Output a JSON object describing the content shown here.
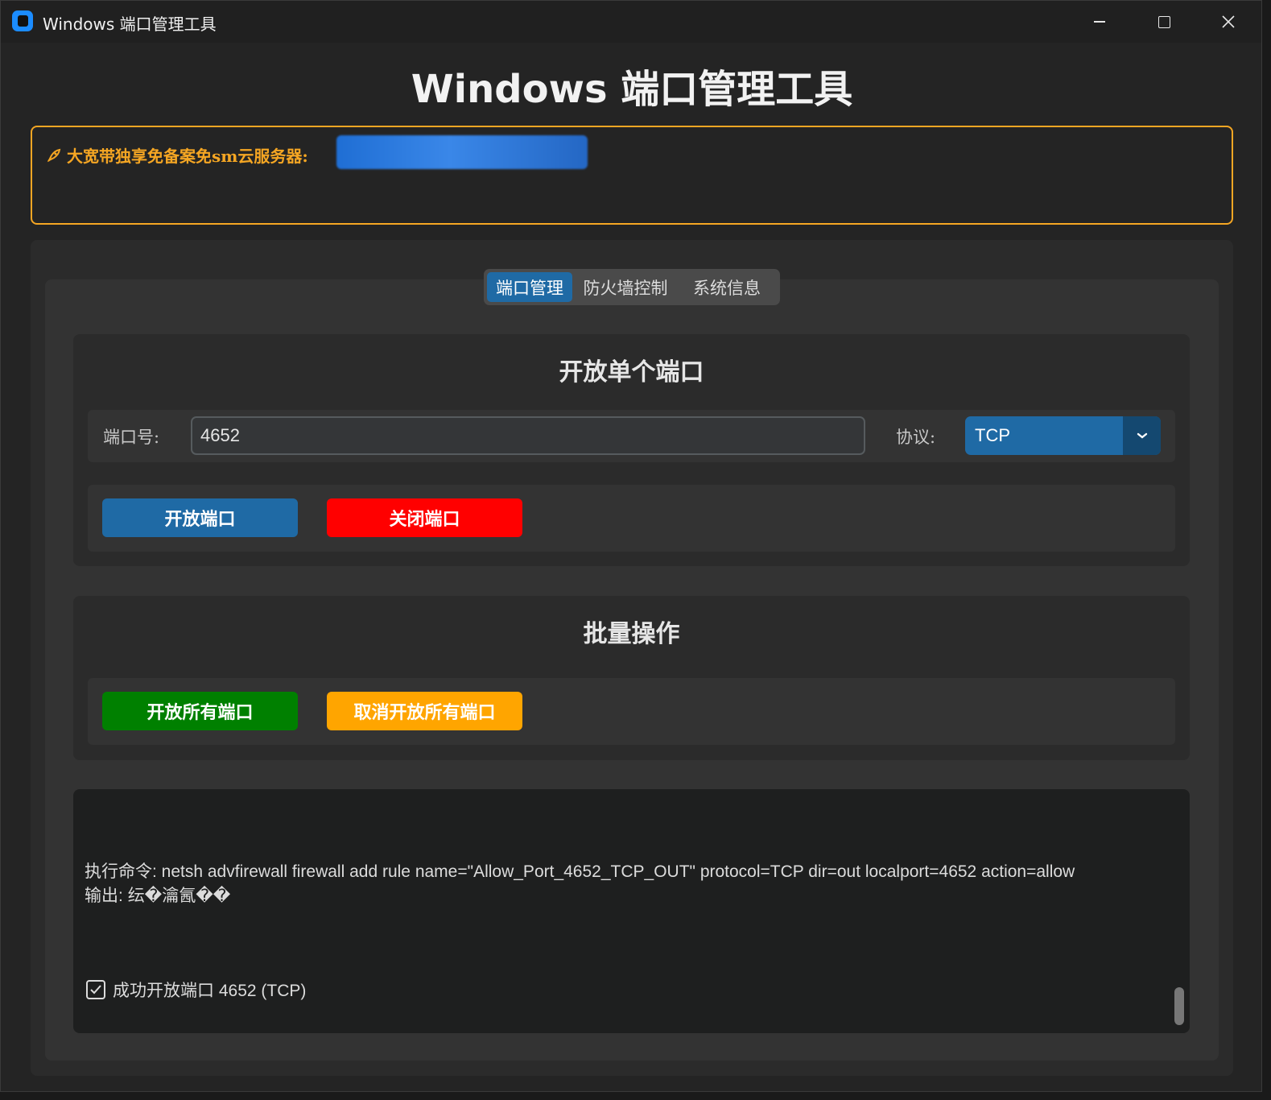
{
  "window": {
    "title": "Windows 端口管理工具",
    "app_icon": "app-icon",
    "controls": [
      "minimize-icon",
      "maximize-icon",
      "close-icon"
    ]
  },
  "header": {
    "title": "Windows 端口管理工具"
  },
  "ad": {
    "icon": "rocket-icon",
    "label": "大宽带独享免备案免sm云服务器:",
    "accent": "#f5a623"
  },
  "tabs": [
    {
      "label": "端口管理",
      "active": true
    },
    {
      "label": "防火墙控制",
      "active": false
    },
    {
      "label": "系统信息",
      "active": false
    }
  ],
  "single_port": {
    "title": "开放单个端口",
    "port_label": "端口号:",
    "port_value": "4652",
    "protocol_label": "协议:",
    "protocol_value": "TCP",
    "open_button": "开放端口",
    "close_button": "关闭端口"
  },
  "batch": {
    "title": "批量操作",
    "open_all_button": "开放所有端口",
    "cancel_all_button": "取消开放所有端口"
  },
  "console": {
    "line1": "执行命令: netsh advfirewall firewall add rule name=\"Allow_Port_4652_TCP_OUT\" protocol=TCP dir=out localport=4652 action=allow",
    "line2": "输出: 纭�瀹氥��",
    "line3": "成功开放端口 4652 (TCP)",
    "status_icon": "checkbox-check-icon"
  },
  "colors": {
    "primary_blue": "#1f6aa5",
    "danger_red": "#ff0000",
    "success_green": "#008000",
    "warning_orange": "#ffa500",
    "ad_border": "#f5a623"
  }
}
